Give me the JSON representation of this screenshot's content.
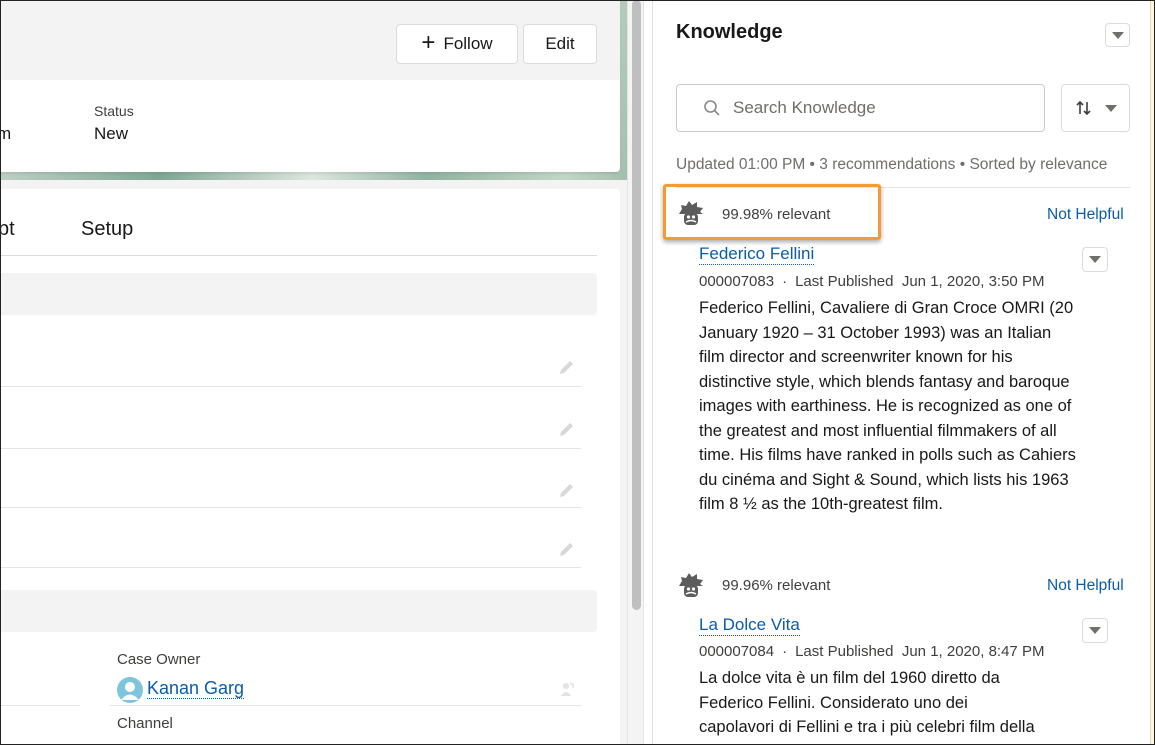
{
  "record": {
    "follow_label": "Follow",
    "edit_label": "Edit",
    "partial_field_value": "m",
    "status_label": "Status",
    "status_value": "New",
    "tabs": [
      {
        "label": "pt"
      },
      {
        "label": "Setup"
      }
    ],
    "case_owner_label": "Case Owner",
    "case_owner_name": "Kanan Garg",
    "channel_label": "Channel"
  },
  "knowledge": {
    "title": "Knowledge",
    "search_placeholder": "Search Knowledge",
    "search_value": "",
    "meta": "Updated 01:00 PM • 3 recommendations • Sorted by relevance",
    "highlight_color": "#f39c33",
    "articles": [
      {
        "relevance": "99.98% relevant",
        "not_helpful_label": "Not Helpful",
        "title": "Federico Fellini",
        "number": "000007083",
        "published_label": "Last Published",
        "published_date": "Jun 1, 2020, 3:50 PM",
        "body": "Federico Fellini, Cavaliere di Gran Croce OMRI (20 January 1920 – 31 October 1993) was an Italian film director and screenwriter known for his distinctive style, which blends fantasy and baroque images with earthiness. He is recognized as one of the greatest and most influential filmmakers of all time. His films have ranked in polls such as Cahiers du cinéma and Sight & Sound, which lists his 1963 film 8 ½ as the 10th-greatest film."
      },
      {
        "relevance": "99.96% relevant",
        "not_helpful_label": "Not Helpful",
        "title": "La Dolce Vita",
        "number": "000007084",
        "published_label": "Last Published",
        "published_date": "Jun 1, 2020, 8:47 PM",
        "body": "La dolce vita è un film del 1960 diretto da Federico Fellini. Considerato uno dei capolavori di Fellini e tra i più celebri film della"
      }
    ]
  }
}
